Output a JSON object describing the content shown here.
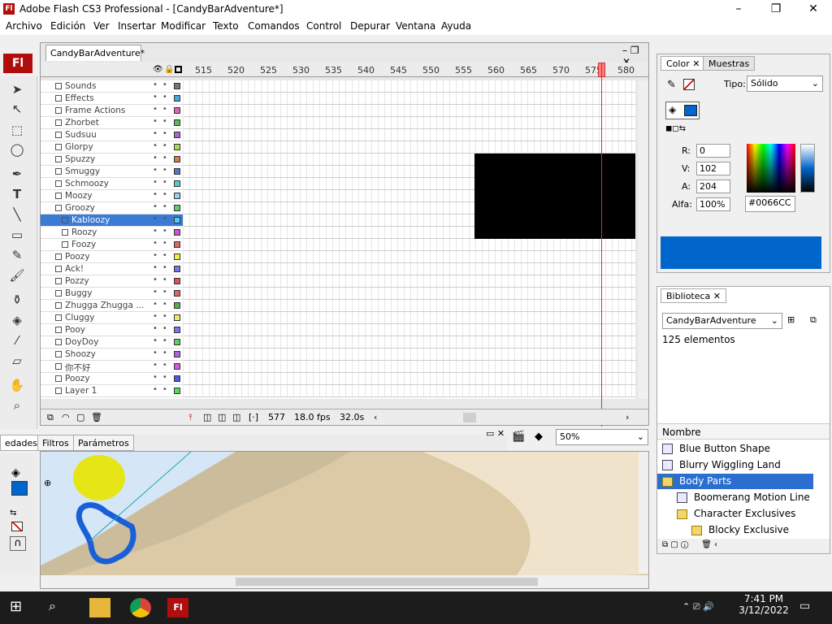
{
  "window": {
    "title": "Adobe Flash CS3 Professional - [CandyBarAdventure*]",
    "app_icon": "Fl"
  },
  "menu": [
    "Archivo",
    "Edición",
    "Ver",
    "Insertar",
    "Modificar",
    "Texto",
    "Comandos",
    "Control",
    "Depurar",
    "Ventana",
    "Ayuda"
  ],
  "document": {
    "tab_label": "CandyBarAdventure*"
  },
  "timeline": {
    "frame_numbers": [
      "515",
      "520",
      "525",
      "530",
      "535",
      "540",
      "545",
      "550",
      "555",
      "560",
      "565",
      "570",
      "575",
      "580"
    ],
    "layers": [
      "Sounds",
      "Effects",
      "Frame Actions",
      "Zhorbet",
      "Sudsuu",
      "Glorpy",
      "Spuzzy",
      "Smuggy",
      "Schmoozy",
      "Moozy",
      "Groozy",
      "Kabloozy",
      "Roozy",
      "Foozy",
      "Poozy",
      "Ack!",
      "Pozzy",
      "Buggy",
      "Zhugga Zhugga ...",
      "Cluggy",
      "Pooy",
      "DoyDoy",
      "Shoozy",
      "你不好",
      "Poozy",
      "Layer 1"
    ],
    "selected_layer": "Kabloozy",
    "current_frame": "577",
    "fps": "18.0 fps",
    "time": "32.0s"
  },
  "properties": {
    "tab_left": "edades",
    "tab_filters": "Filtros",
    "tab_params": "Parámetros",
    "zoom": "50%"
  },
  "color_panel": {
    "tab_color": "Color",
    "tab_swatches": "Muestras",
    "type_label": "Tipo:",
    "type_value": "Sólido",
    "r_label": "R:",
    "r_value": "0",
    "g_label": "V:",
    "g_value": "102",
    "b_label": "A:",
    "b_value": "204",
    "alpha_label": "Alfa:",
    "alpha_value": "100%",
    "hex_value": "#0066CC",
    "swatch_color": "#0066CC"
  },
  "library": {
    "tab_label": "Biblioteca",
    "doc_select": "CandyBarAdventure",
    "count": "125 elementos",
    "column_name": "Nombre",
    "items": [
      {
        "name": "Blue Button Shape",
        "kind": "symbol",
        "indent": 0
      },
      {
        "name": "Blurry Wiggling Land",
        "kind": "symbol",
        "indent": 0
      },
      {
        "name": "Body Parts",
        "kind": "folder",
        "indent": 0,
        "selected": true
      },
      {
        "name": "Boomerang Motion Line",
        "kind": "symbol",
        "indent": 1
      },
      {
        "name": "Character Exclusives",
        "kind": "folder",
        "indent": 1
      },
      {
        "name": "Blocky Exclusive",
        "kind": "folder",
        "indent": 2
      }
    ]
  },
  "taskbar": {
    "time": "7:41 PM",
    "date": "3/12/2022",
    "pinned": [
      "start-icon",
      "search-icon",
      "file-explorer-icon",
      "chrome-icon",
      "flash-icon"
    ]
  }
}
